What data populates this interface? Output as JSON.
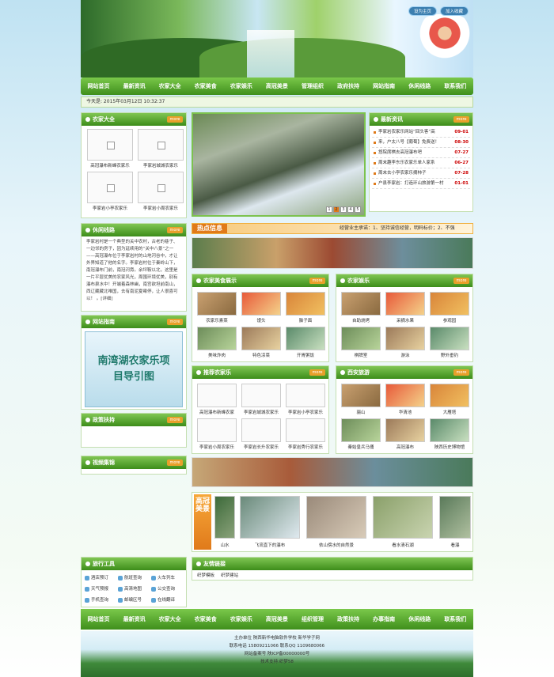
{
  "toplinks": [
    "设为主页",
    "加入收藏"
  ],
  "nav": [
    "网站首页",
    "最新资讯",
    "农家大全",
    "农家美食",
    "农家娱乐",
    "高冠美景",
    "管理组织",
    "政府扶持",
    "网站指南",
    "休闲线路",
    "联系我们"
  ],
  "date": "今天是: 2015年03月12日 10:32:37",
  "more": "more",
  "left": {
    "dajuan": {
      "title": "农家大全",
      "items": [
        "高冠瀑布新峰农家乐",
        "李家岩城城农家乐",
        "李家岩小亭农家乐",
        "李家岩小周农家乐"
      ]
    },
    "xiuxian": {
      "title": "休闲线路",
      "text": "李家岩村是一个典型的关中农村，古老的巷子、一边邻的房子，因为延续用的“关中八景”之一——高冠瀑布位于李家岩村的山地河谷中，才让外界知道了他的名字。李家岩村位于秦岭山下，南冠瀑布门前，南冠河旁。余坪鞍以北，这里是一片平层优美的农家风光，周围环境优美，别有瀑布泉水中！开端着森林幽，南宫欲坦前南山，西辽藏藏北唯国，去有南泥夏霉停，让人很喜可以！ 。[详细]"
    },
    "zhinan": {
      "title": "网站指南",
      "img_text": "南湾湖农家乐项目导引图"
    },
    "zhengce": {
      "title": "政策扶持"
    },
    "shipin": {
      "title": "视频集锦"
    },
    "tools": {
      "title": "旅行工具",
      "items": [
        "酒店预订",
        "航班查询",
        "火车列车",
        "天气预报",
        "高清地图",
        "公交查询",
        "手机查询",
        "邮编区号",
        "在线翻译"
      ]
    }
  },
  "center": {
    "slider_pages": [
      "1",
      "2",
      "3",
      "4",
      "5"
    ],
    "hot_title": "热点信息",
    "hot_scroll": "经营业主承诺：1、坚持诚信经营，明码标价；2、不强",
    "meishi": {
      "title": "农家美食展示",
      "items": [
        "农家乐素菜",
        "馒头",
        "臊子面",
        "美味炸肉",
        "特色凉菜",
        "开胃粥饭"
      ]
    },
    "yule": {
      "title": "农家娱乐",
      "items": [
        "自助烧烤",
        "采摘水果",
        "参观园",
        "棋牌室",
        "游泳",
        "野外垂钓"
      ]
    },
    "tuijian": {
      "title": "推荐农家乐",
      "items": [
        "高冠瀑布新峰农家",
        "李家岩城城农家乐",
        "李家岩小亭农家乐",
        "李家岩小周农家乐",
        "李家岩长升农家乐",
        "李家岩秀行农家乐"
      ]
    },
    "xian": {
      "title": "西安旅游",
      "items": [
        "骊山",
        "华清池",
        "大雁塔",
        "秦始皇兵马俑",
        "高冠瀑布",
        "陕西历史博物馆"
      ]
    },
    "gaoguan": {
      "title": "高冠美景",
      "items": [
        "山水",
        "飞流直下的瀑布",
        "依山傍水的自然景",
        "看水清石湖",
        "看瀑"
      ]
    },
    "links": {
      "title": "友情链接",
      "items": [
        "织梦模板",
        "织梦建站"
      ]
    }
  },
  "news": {
    "title": "最新资讯",
    "items": [
      {
        "t": "李家岩农家乐网站“回头客”高",
        "d": "09-01"
      },
      {
        "t": "来，户太八号【葡萄】免费送！",
        "d": "08-30"
      },
      {
        "t": "悠院席棋去高冠瀑布吧",
        "d": "07-27"
      },
      {
        "t": "周末趣李东乐农家乐单人家系",
        "d": "06-27"
      },
      {
        "t": "周末去小亭农家乐摘柿子",
        "d": "07-28"
      },
      {
        "t": "户县李家岩：打造环山旅游第一村",
        "d": "01-01"
      }
    ]
  },
  "footer": {
    "nav": [
      "网站首页",
      "最新资讯",
      "农家大全",
      "农家美食",
      "农家娱乐",
      "高冠美景",
      "组织管理",
      "政策扶持",
      "办事指南",
      "休闲线路",
      "联系我们"
    ],
    "lines": [
      "主办单位 陕西新华电脑软件学校 新华学子网",
      "联系电话 15809211066 联系QQ 1109680066",
      "网站备案号 陕ICP备00000000号",
      "技术支持:织梦58"
    ]
  }
}
